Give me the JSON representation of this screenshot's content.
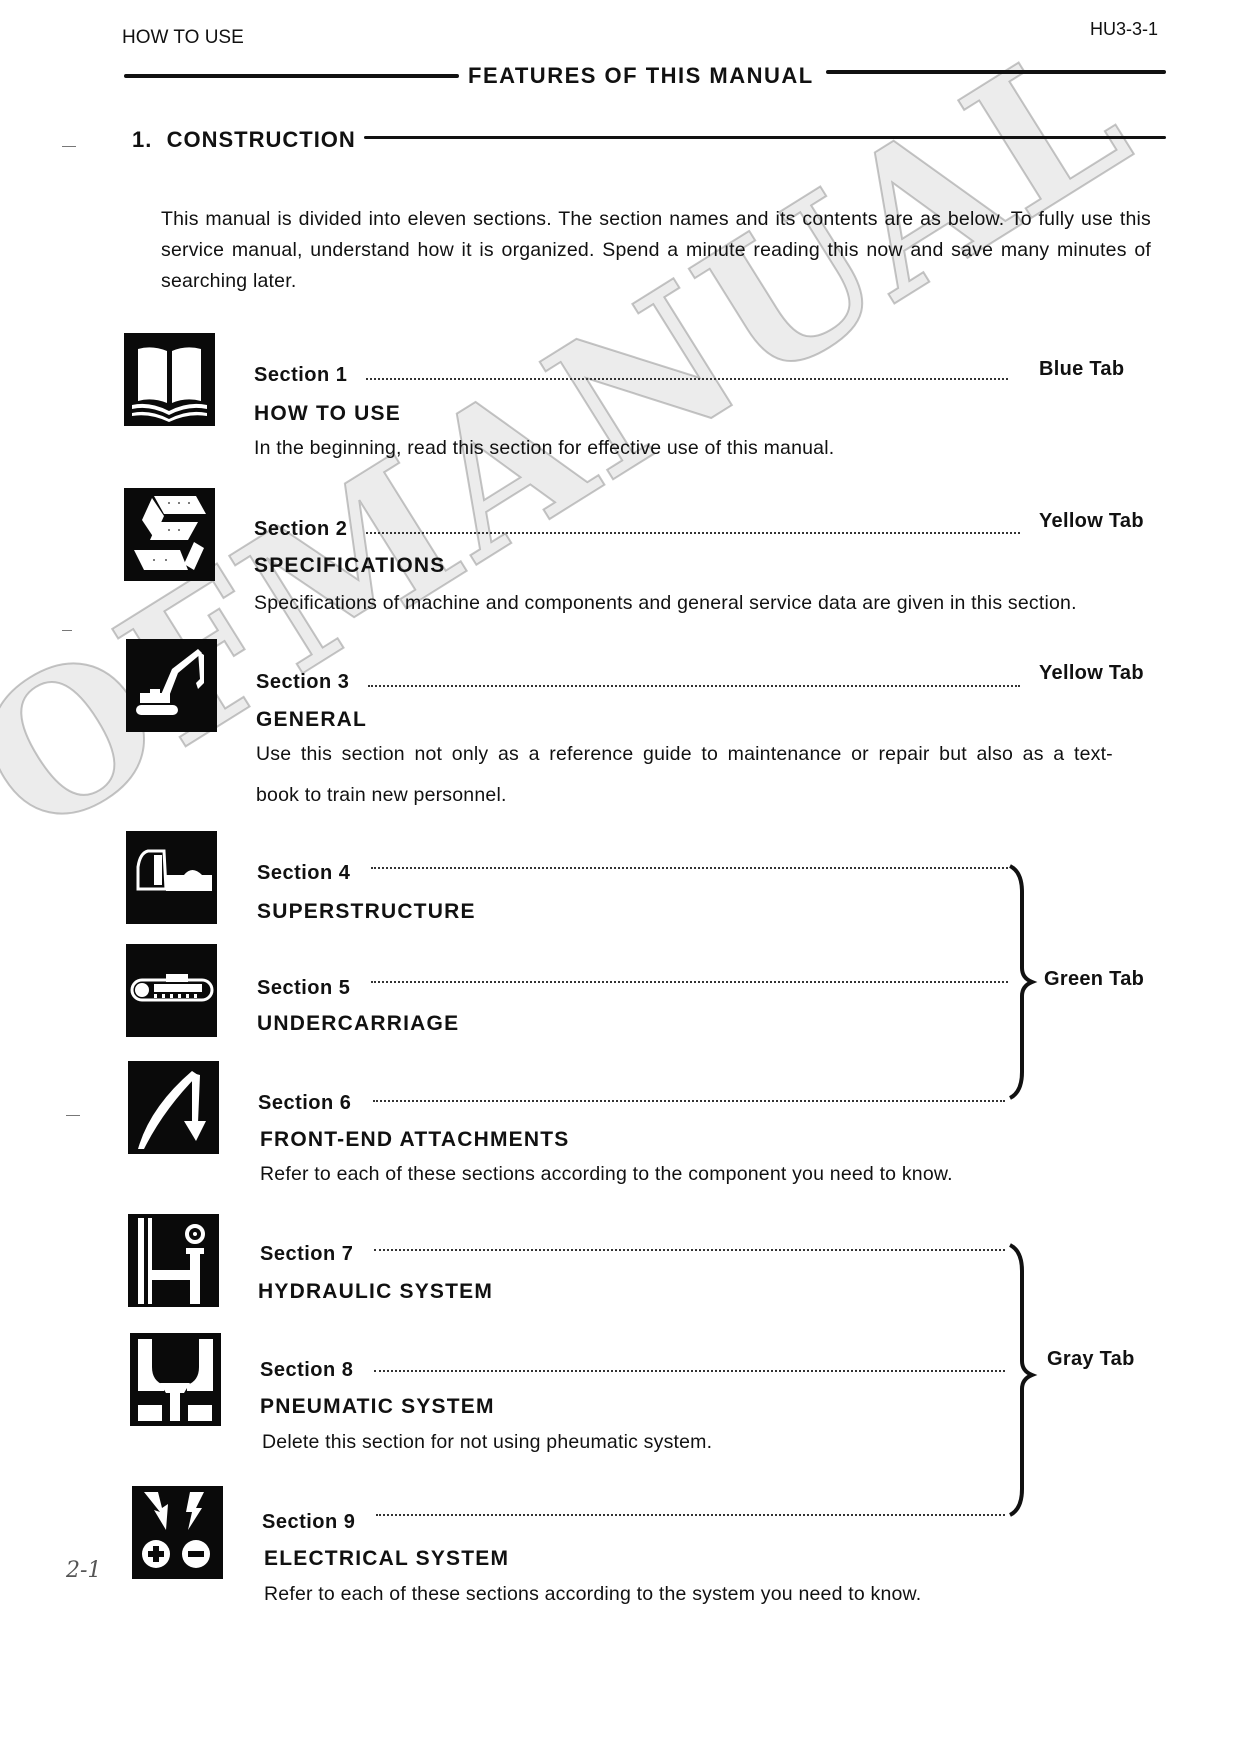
{
  "header": {
    "section_name": "HOW TO USE",
    "page_code": "HU3-3-1"
  },
  "title": "FEATURES OF THIS MANUAL",
  "subsection": {
    "number": "1.",
    "heading": "CONSTRUCTION"
  },
  "intro": "This manual is divided into eleven sections. The section names and its contents are as below. To fully use this service manual, understand how it is organized. Spend a minute reading this now and save many minutes of searching later.",
  "sections": [
    {
      "label": "Section  1",
      "title": "HOW TO USE",
      "desc": "In the beginning, read this section for effective use of this manual.",
      "icon": "book-icon",
      "tab": "Blue Tab"
    },
    {
      "label": "Section  2",
      "title": "SPECIFICATIONS",
      "desc": "Specifications of machine and components and general service data are given in this section.",
      "icon": "specifications-icon",
      "tab": "Yellow Tab"
    },
    {
      "label": "Section  3",
      "title": "GENERAL",
      "desc": "Use this section not only as a reference guide to maintenance or repair but also as a text-",
      "desc2": "book to train new personnel.",
      "icon": "excavator-icon",
      "tab": "Yellow Tab"
    },
    {
      "label": "Section  4",
      "title": "SUPERSTRUCTURE",
      "icon": "superstructure-icon"
    },
    {
      "label": "Section  5",
      "title": "UNDERCARRIAGE",
      "icon": "undercarriage-icon"
    },
    {
      "label": "Section  6",
      "title": "FRONT-END  ATTACHMENTS",
      "desc": "Refer to each of these sections according to the component you need to know.",
      "icon": "front-attachment-icon"
    },
    {
      "label": "Section  7",
      "title": "HYDRAULIC SYSTEM",
      "icon": "hydraulic-icon"
    },
    {
      "label": "Section  8",
      "title": "PNEUMATIC SYSTEM",
      "desc": "Delete this section for not using pheumatic system.",
      "icon": "pneumatic-icon"
    },
    {
      "label": "Section  9",
      "title": "ELECTRICAL  SYSTEM",
      "desc": "Refer to each of these sections according to the system you need to know.",
      "icon": "electrical-icon"
    }
  ],
  "group_tabs": {
    "green": "Green Tab",
    "gray": "Gray Tab"
  },
  "watermark": "OFMANUAL",
  "margin_note": "2-1"
}
